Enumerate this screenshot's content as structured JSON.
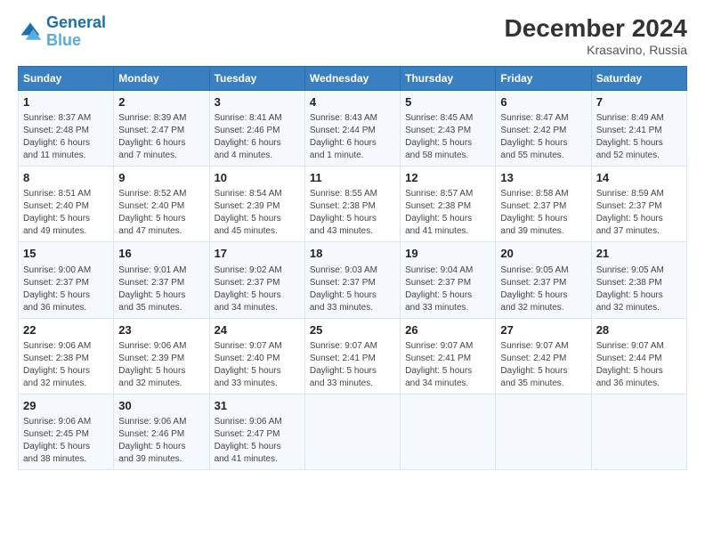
{
  "logo": {
    "line1": "General",
    "line2": "Blue"
  },
  "title": "December 2024",
  "subtitle": "Krasavino, Russia",
  "days_of_week": [
    "Sunday",
    "Monday",
    "Tuesday",
    "Wednesday",
    "Thursday",
    "Friday",
    "Saturday"
  ],
  "weeks": [
    [
      {
        "day": "1",
        "info": "Sunrise: 8:37 AM\nSunset: 2:48 PM\nDaylight: 6 hours\nand 11 minutes."
      },
      {
        "day": "2",
        "info": "Sunrise: 8:39 AM\nSunset: 2:47 PM\nDaylight: 6 hours\nand 7 minutes."
      },
      {
        "day": "3",
        "info": "Sunrise: 8:41 AM\nSunset: 2:46 PM\nDaylight: 6 hours\nand 4 minutes."
      },
      {
        "day": "4",
        "info": "Sunrise: 8:43 AM\nSunset: 2:44 PM\nDaylight: 6 hours\nand 1 minute."
      },
      {
        "day": "5",
        "info": "Sunrise: 8:45 AM\nSunset: 2:43 PM\nDaylight: 5 hours\nand 58 minutes."
      },
      {
        "day": "6",
        "info": "Sunrise: 8:47 AM\nSunset: 2:42 PM\nDaylight: 5 hours\nand 55 minutes."
      },
      {
        "day": "7",
        "info": "Sunrise: 8:49 AM\nSunset: 2:41 PM\nDaylight: 5 hours\nand 52 minutes."
      }
    ],
    [
      {
        "day": "8",
        "info": "Sunrise: 8:51 AM\nSunset: 2:40 PM\nDaylight: 5 hours\nand 49 minutes."
      },
      {
        "day": "9",
        "info": "Sunrise: 8:52 AM\nSunset: 2:40 PM\nDaylight: 5 hours\nand 47 minutes."
      },
      {
        "day": "10",
        "info": "Sunrise: 8:54 AM\nSunset: 2:39 PM\nDaylight: 5 hours\nand 45 minutes."
      },
      {
        "day": "11",
        "info": "Sunrise: 8:55 AM\nSunset: 2:38 PM\nDaylight: 5 hours\nand 43 minutes."
      },
      {
        "day": "12",
        "info": "Sunrise: 8:57 AM\nSunset: 2:38 PM\nDaylight: 5 hours\nand 41 minutes."
      },
      {
        "day": "13",
        "info": "Sunrise: 8:58 AM\nSunset: 2:37 PM\nDaylight: 5 hours\nand 39 minutes."
      },
      {
        "day": "14",
        "info": "Sunrise: 8:59 AM\nSunset: 2:37 PM\nDaylight: 5 hours\nand 37 minutes."
      }
    ],
    [
      {
        "day": "15",
        "info": "Sunrise: 9:00 AM\nSunset: 2:37 PM\nDaylight: 5 hours\nand 36 minutes."
      },
      {
        "day": "16",
        "info": "Sunrise: 9:01 AM\nSunset: 2:37 PM\nDaylight: 5 hours\nand 35 minutes."
      },
      {
        "day": "17",
        "info": "Sunrise: 9:02 AM\nSunset: 2:37 PM\nDaylight: 5 hours\nand 34 minutes."
      },
      {
        "day": "18",
        "info": "Sunrise: 9:03 AM\nSunset: 2:37 PM\nDaylight: 5 hours\nand 33 minutes."
      },
      {
        "day": "19",
        "info": "Sunrise: 9:04 AM\nSunset: 2:37 PM\nDaylight: 5 hours\nand 33 minutes."
      },
      {
        "day": "20",
        "info": "Sunrise: 9:05 AM\nSunset: 2:37 PM\nDaylight: 5 hours\nand 32 minutes."
      },
      {
        "day": "21",
        "info": "Sunrise: 9:05 AM\nSunset: 2:38 PM\nDaylight: 5 hours\nand 32 minutes."
      }
    ],
    [
      {
        "day": "22",
        "info": "Sunrise: 9:06 AM\nSunset: 2:38 PM\nDaylight: 5 hours\nand 32 minutes."
      },
      {
        "day": "23",
        "info": "Sunrise: 9:06 AM\nSunset: 2:39 PM\nDaylight: 5 hours\nand 32 minutes."
      },
      {
        "day": "24",
        "info": "Sunrise: 9:07 AM\nSunset: 2:40 PM\nDaylight: 5 hours\nand 33 minutes."
      },
      {
        "day": "25",
        "info": "Sunrise: 9:07 AM\nSunset: 2:41 PM\nDaylight: 5 hours\nand 33 minutes."
      },
      {
        "day": "26",
        "info": "Sunrise: 9:07 AM\nSunset: 2:41 PM\nDaylight: 5 hours\nand 34 minutes."
      },
      {
        "day": "27",
        "info": "Sunrise: 9:07 AM\nSunset: 2:42 PM\nDaylight: 5 hours\nand 35 minutes."
      },
      {
        "day": "28",
        "info": "Sunrise: 9:07 AM\nSunset: 2:44 PM\nDaylight: 5 hours\nand 36 minutes."
      }
    ],
    [
      {
        "day": "29",
        "info": "Sunrise: 9:06 AM\nSunset: 2:45 PM\nDaylight: 5 hours\nand 38 minutes."
      },
      {
        "day": "30",
        "info": "Sunrise: 9:06 AM\nSunset: 2:46 PM\nDaylight: 5 hours\nand 39 minutes."
      },
      {
        "day": "31",
        "info": "Sunrise: 9:06 AM\nSunset: 2:47 PM\nDaylight: 5 hours\nand 41 minutes."
      },
      {
        "day": "",
        "info": ""
      },
      {
        "day": "",
        "info": ""
      },
      {
        "day": "",
        "info": ""
      },
      {
        "day": "",
        "info": ""
      }
    ]
  ]
}
